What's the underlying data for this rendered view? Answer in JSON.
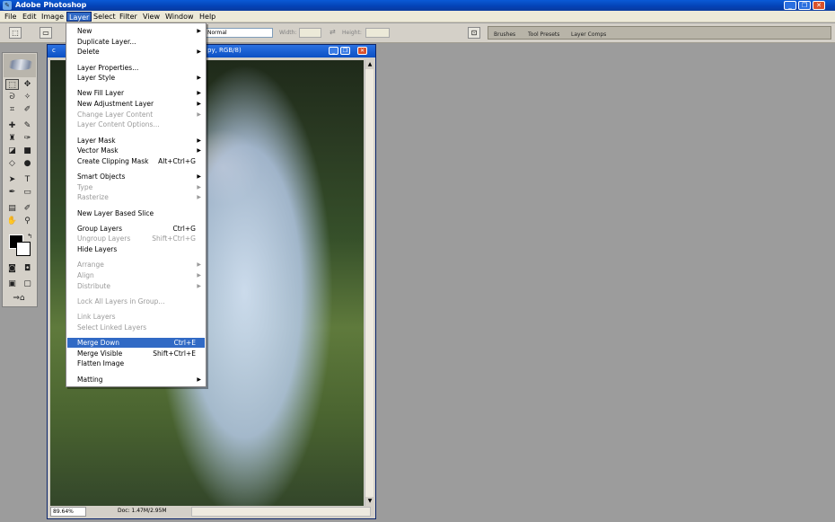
{
  "window": {
    "title": "Adobe Photoshop",
    "icon": "photoshop-feather-icon",
    "controls": [
      "_",
      "❐",
      "✕"
    ]
  },
  "menubar": {
    "items": [
      "File",
      "Edit",
      "Image",
      "Layer",
      "Select",
      "Filter",
      "View",
      "Window",
      "Help"
    ],
    "active": "Layer"
  },
  "options": {
    "style_value": "Normal",
    "width_label": "Width:",
    "height_label": "Height:",
    "palette_tabs": [
      "Brushes",
      "Tool Presets",
      "Layer Comps"
    ]
  },
  "document": {
    "title_partial": "py, RGB/8)",
    "title_prefix": "c",
    "zoom": "89.64%",
    "doc_info": "Doc: 1.47M/2.95M"
  },
  "layer_menu": {
    "groups": [
      [
        {
          "label": "New",
          "submenu": true
        },
        {
          "label": "Duplicate Layer...",
          "submenu": false
        },
        {
          "label": "Delete",
          "submenu": true
        }
      ],
      [
        {
          "label": "Layer Properties...",
          "submenu": false
        },
        {
          "label": "Layer Style",
          "submenu": true
        }
      ],
      [
        {
          "label": "New Fill Layer",
          "submenu": true
        },
        {
          "label": "New Adjustment Layer",
          "submenu": true
        },
        {
          "label": "Change Layer Content",
          "submenu": true,
          "disabled": true
        },
        {
          "label": "Layer Content Options...",
          "disabled": true
        }
      ],
      [
        {
          "label": "Layer Mask",
          "submenu": true
        },
        {
          "label": "Vector Mask",
          "submenu": true
        },
        {
          "label": "Create Clipping Mask",
          "shortcut": "Alt+Ctrl+G"
        }
      ],
      [
        {
          "label": "Smart Objects",
          "submenu": true
        },
        {
          "label": "Type",
          "submenu": true,
          "disabled": true
        },
        {
          "label": "Rasterize",
          "submenu": true,
          "disabled": true
        }
      ],
      [
        {
          "label": "New Layer Based Slice"
        }
      ],
      [
        {
          "label": "Group Layers",
          "shortcut": "Ctrl+G"
        },
        {
          "label": "Ungroup Layers",
          "shortcut": "Shift+Ctrl+G",
          "disabled": true
        },
        {
          "label": "Hide Layers"
        }
      ],
      [
        {
          "label": "Arrange",
          "submenu": true,
          "disabled": true
        },
        {
          "label": "Align",
          "submenu": true,
          "disabled": true
        },
        {
          "label": "Distribute",
          "submenu": true,
          "disabled": true
        }
      ],
      [
        {
          "label": "Lock All Layers in Group...",
          "disabled": true
        }
      ],
      [
        {
          "label": "Link Layers",
          "disabled": true
        },
        {
          "label": "Select Linked Layers",
          "disabled": true
        }
      ],
      [
        {
          "label": "Merge Down",
          "shortcut": "Ctrl+E",
          "highlighted": true
        },
        {
          "label": "Merge Visible",
          "shortcut": "Shift+Ctrl+E"
        },
        {
          "label": "Flatten Image"
        }
      ],
      [
        {
          "label": "Matting",
          "submenu": true
        }
      ]
    ]
  },
  "colors": {
    "highlight": "#316ac5",
    "titlebar": "#0442b5",
    "workspace": "#9c9c9c"
  }
}
